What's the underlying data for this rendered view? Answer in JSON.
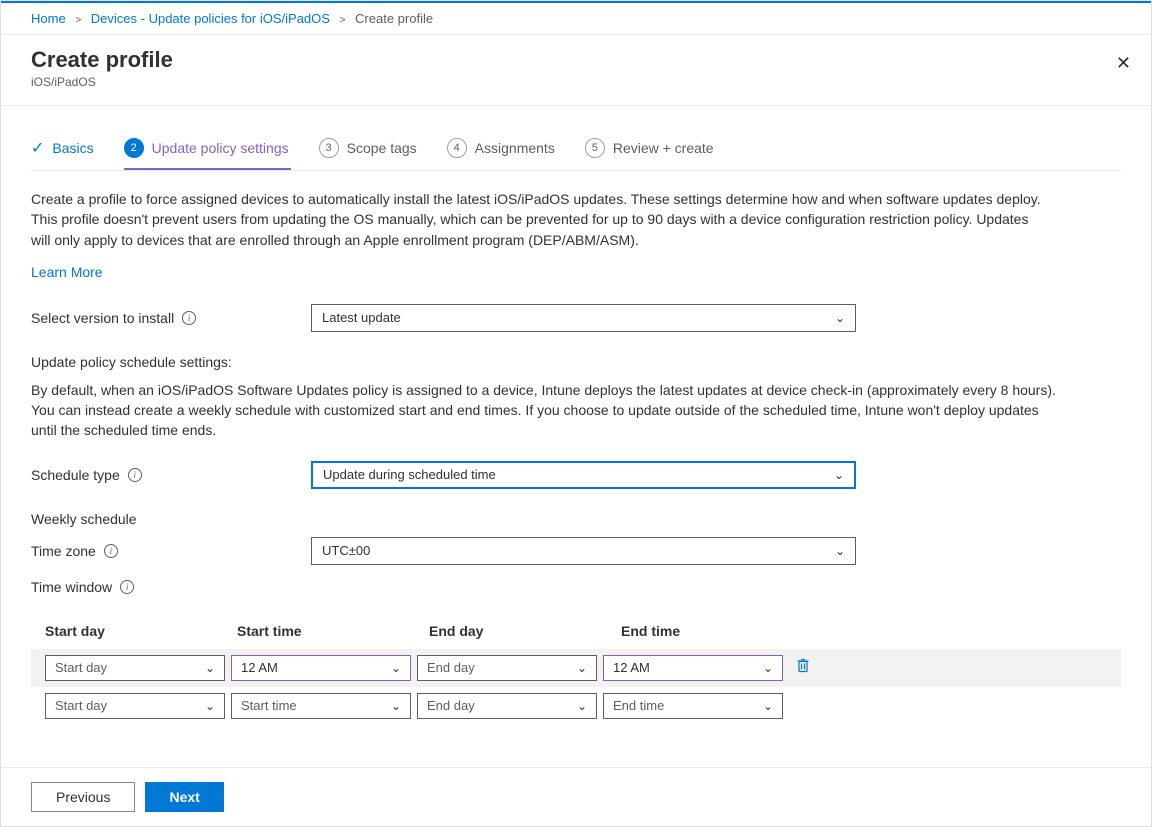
{
  "breadcrumbs": {
    "home": "Home",
    "devices": "Devices - Update policies for iOS/iPadOS",
    "current": "Create profile"
  },
  "header": {
    "title": "Create profile",
    "subtitle": "iOS/iPadOS"
  },
  "tabs": {
    "basics": "Basics",
    "update_settings": "Update policy settings",
    "scope_tags": "Scope tags",
    "assignments": "Assignments",
    "review": "Review + create",
    "num2": "2",
    "num3": "3",
    "num4": "4",
    "num5": "5"
  },
  "body": {
    "description": "Create a profile to force assigned devices to automatically install the latest iOS/iPadOS updates. These settings determine how and when software updates deploy. This profile doesn't prevent users from updating the OS manually, which can be prevented for up to 90 days with a device configuration restriction policy. Updates will only apply to devices that are enrolled through an Apple enrollment program (DEP/ABM/ASM).",
    "learn_more": "Learn More",
    "version_label": "Select version to install",
    "version_value": "Latest update",
    "schedule_settings_label": "Update policy schedule settings:",
    "schedule_settings_text": "By default, when an iOS/iPadOS Software Updates policy is assigned to a device, Intune deploys the latest updates at device check-in (approximately every 8 hours). You can instead create a weekly schedule with customized start and end times. If you choose to update outside of the scheduled time, Intune won't deploy updates until the scheduled time ends.",
    "schedule_type_label": "Schedule type",
    "schedule_type_value": "Update during scheduled time",
    "weekly_schedule_label": "Weekly schedule",
    "time_zone_label": "Time zone",
    "time_zone_value": "UTC±00",
    "time_window_label": "Time window"
  },
  "table": {
    "headers": {
      "start_day": "Start day",
      "start_time": "Start time",
      "end_day": "End day",
      "end_time": "End time"
    },
    "row1": {
      "start_day": "Start day",
      "start_time": "12 AM",
      "end_day": "End day",
      "end_time": "12 AM"
    },
    "row2": {
      "start_day": "Start day",
      "start_time": "Start time",
      "end_day": "End day",
      "end_time": "End time"
    }
  },
  "footer": {
    "previous": "Previous",
    "next": "Next"
  }
}
